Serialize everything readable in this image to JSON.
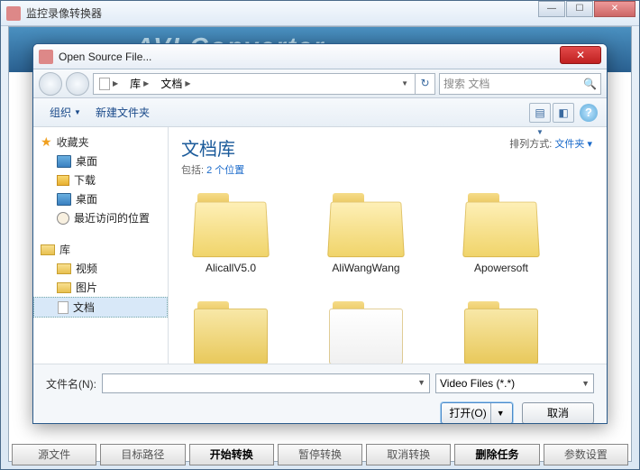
{
  "parent": {
    "title": "监控录像转换器",
    "banner": "AVI Converter",
    "footer": [
      "源文件",
      "目标路径",
      "开始转换",
      "暂停转换",
      "取消转换",
      "删除任务",
      "参数设置"
    ]
  },
  "dialog": {
    "title": "Open Source File...",
    "breadcrumb": {
      "seg1": "库",
      "seg2": "文档"
    },
    "search_placeholder": "搜索 文档",
    "toolbar": {
      "organize": "组织",
      "new_folder": "新建文件夹"
    },
    "tree": {
      "fav_header": "收藏夹",
      "fav_items": [
        "桌面",
        "下载",
        "桌面",
        "最近访问的位置"
      ],
      "lib_header": "库",
      "lib_items": [
        "视频",
        "图片",
        "文档"
      ]
    },
    "content": {
      "title": "文档库",
      "sub_prefix": "包括: ",
      "sub_link": "2 个位置",
      "sort_label": "排列方式:",
      "sort_value": "文件夹",
      "folders": [
        "AlicallV5.0",
        "AliWangWang",
        "Apowersoft"
      ]
    },
    "bottom": {
      "filename_label": "文件名(N):",
      "filter": "Video Files (*.*)",
      "open": "打开(O)",
      "cancel": "取消"
    }
  }
}
